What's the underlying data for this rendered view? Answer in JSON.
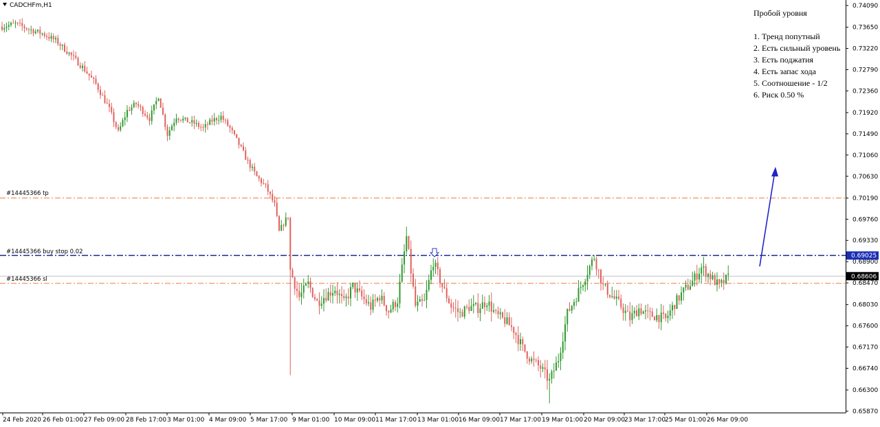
{
  "window": {
    "title": "CADCHFm,H1"
  },
  "annotation": {
    "title": "Пробой уровня",
    "items": [
      "1. Тренд попутный",
      "2. Есть сильный уровень",
      "3. Есть поджатия",
      "4. Есть запас хода",
      "5. Соотношение - 1/2",
      "6. Риск 0.50 %"
    ]
  },
  "levels": {
    "tp": {
      "label": "#14445366 tp",
      "price": 0.7019,
      "color": "#f07c3c"
    },
    "buy_stop": {
      "label": "#14445366 buy stop 0.02",
      "price": 0.69025,
      "price_label": "0.69025",
      "color": "#1a2a8c"
    },
    "sl": {
      "label": "#14445366 sl",
      "price": 0.6846,
      "color": "#f07c3c"
    },
    "bid": {
      "price": 0.68606,
      "price_label": "0.68606"
    }
  },
  "colors": {
    "bull": "#2e9a2e",
    "bear": "#e0605c",
    "arrow": "#2323c8",
    "grid": "#c8c8c8"
  },
  "chart_data": {
    "type": "candlestick",
    "symbol": "CADCHFm",
    "timeframe": "H1",
    "ylim": [
      0.6587,
      0.7409
    ],
    "y_ticks": [
      "0.74090",
      "0.73650",
      "0.73220",
      "0.72790",
      "0.72360",
      "0.71920",
      "0.71490",
      "0.71060",
      "0.70630",
      "0.70190",
      "0.69760",
      "0.69330",
      "0.68900",
      "0.68470",
      "0.68030",
      "0.67600",
      "0.67170",
      "0.66740",
      "0.66300",
      "0.65870"
    ],
    "x_ticks": [
      "24 Feb 2020",
      "26 Feb 01:00",
      "27 Feb 09:00",
      "28 Feb 17:00",
      "3 Mar 01:00",
      "4 Mar 09:00",
      "5 Mar 17:00",
      "9 Mar 01:00",
      "10 Mar 09:00",
      "11 Mar 17:00",
      "13 Mar 01:00",
      "16 Mar 09:00",
      "17 Mar 17:00",
      "19 Mar 01:00",
      "20 Mar 09:00",
      "23 Mar 17:00",
      "25 Mar 01:00",
      "26 Mar 09:00"
    ],
    "series": [
      {
        "price_path": [
          [
            0,
            0.7366
          ],
          [
            6,
            0.7372
          ],
          [
            12,
            0.7361
          ],
          [
            18,
            0.7352
          ],
          [
            24,
            0.7338
          ],
          [
            30,
            0.7312
          ],
          [
            36,
            0.7284
          ],
          [
            42,
            0.725
          ],
          [
            48,
            0.7199
          ],
          [
            52,
            0.7152
          ],
          [
            56,
            0.7196
          ],
          [
            60,
            0.721
          ],
          [
            66,
            0.718
          ],
          [
            70,
            0.7226
          ],
          [
            74,
            0.7148
          ],
          [
            78,
            0.7184
          ],
          [
            82,
            0.7176
          ],
          [
            86,
            0.717
          ],
          [
            90,
            0.716
          ],
          [
            94,
            0.7176
          ],
          [
            98,
            0.7184
          ],
          [
            102,
            0.716
          ],
          [
            106,
            0.7128
          ],
          [
            110,
            0.7092
          ],
          [
            114,
            0.7062
          ],
          [
            118,
            0.7042
          ],
          [
            122,
            0.7005
          ],
          [
            124,
            0.695
          ],
          [
            126,
            0.6968
          ],
          [
            128,
            0.6982
          ],
          [
            129,
            0.6872
          ],
          [
            133,
            0.6818
          ],
          [
            137,
            0.6845
          ],
          [
            141,
            0.6808
          ],
          [
            145,
            0.6822
          ],
          [
            149,
            0.6835
          ],
          [
            153,
            0.6806
          ],
          [
            157,
            0.684
          ],
          [
            161,
            0.6818
          ],
          [
            165,
            0.6798
          ],
          [
            169,
            0.682
          ],
          [
            173,
            0.679
          ],
          [
            177,
            0.6812
          ],
          [
            181,
            0.694
          ],
          [
            185,
            0.68
          ],
          [
            189,
            0.6808
          ],
          [
            193,
            0.689
          ],
          [
            197,
            0.684
          ],
          [
            201,
            0.68
          ],
          [
            205,
            0.6785
          ],
          [
            209,
            0.6798
          ],
          [
            213,
            0.6796
          ],
          [
            217,
            0.681
          ],
          [
            221,
            0.6782
          ],
          [
            225,
            0.6771
          ],
          [
            229,
            0.6752
          ],
          [
            233,
            0.6715
          ],
          [
            237,
            0.669
          ],
          [
            241,
            0.6675
          ],
          [
            245,
            0.6648
          ],
          [
            249,
            0.6693
          ],
          [
            253,
            0.6785
          ],
          [
            257,
            0.682
          ],
          [
            261,
            0.686
          ],
          [
            265,
            0.69
          ],
          [
            269,
            0.684
          ],
          [
            273,
            0.682
          ],
          [
            277,
            0.68
          ],
          [
            281,
            0.6775
          ],
          [
            285,
            0.6795
          ],
          [
            289,
            0.6782
          ],
          [
            293,
            0.678
          ],
          [
            297,
            0.6773
          ],
          [
            301,
            0.6805
          ],
          [
            305,
            0.683
          ],
          [
            309,
            0.685
          ],
          [
            313,
            0.6878
          ],
          [
            317,
            0.686
          ],
          [
            321,
            0.684
          ],
          [
            325,
            0.6858
          ]
        ]
      }
    ]
  }
}
